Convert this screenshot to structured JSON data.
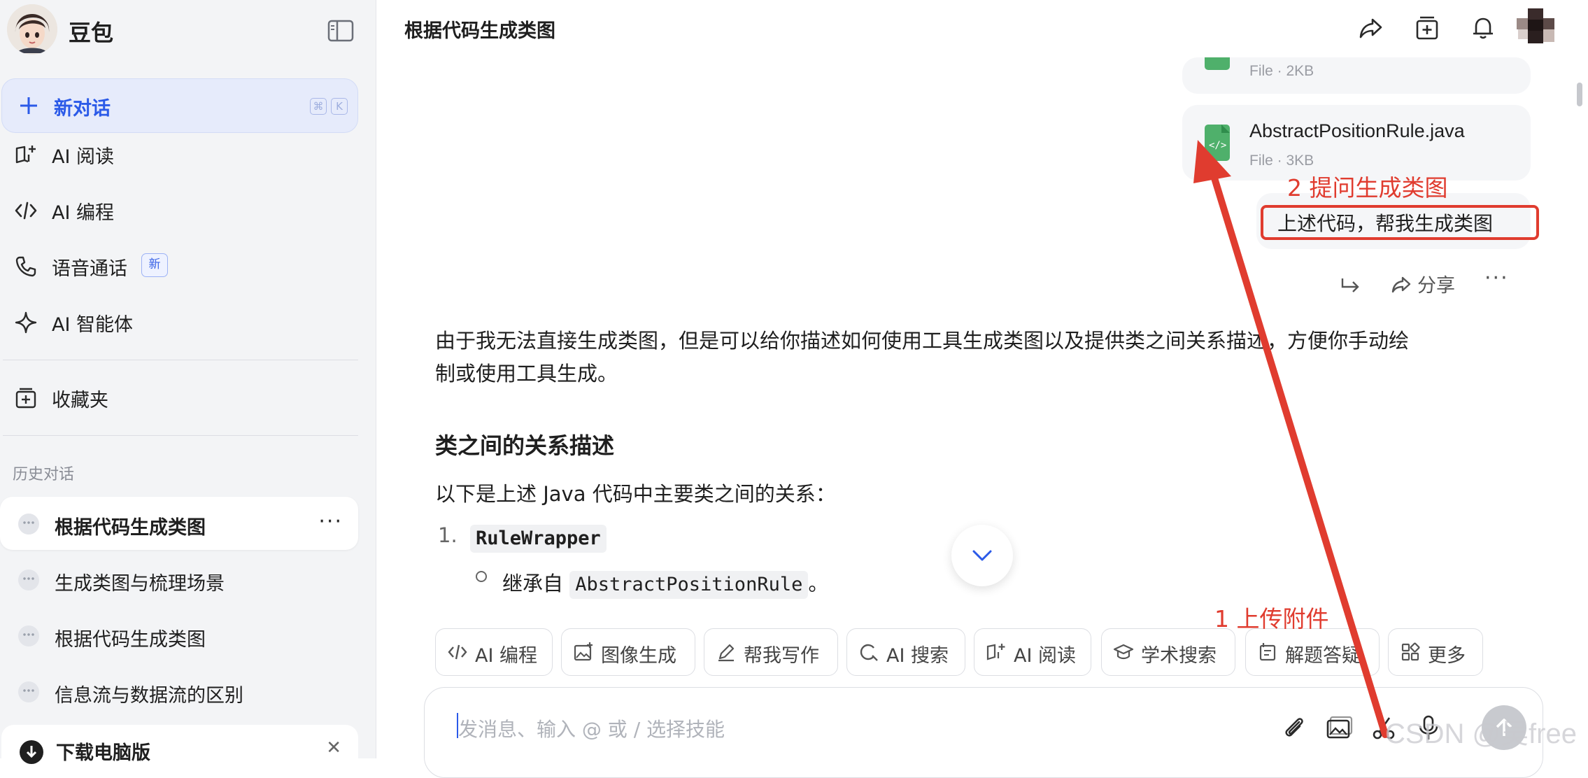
{
  "sidebar": {
    "brand": "豆包",
    "new_chat": "新对话",
    "shortcut": [
      "⌘",
      "K"
    ],
    "nav": [
      {
        "label": "AI 阅读",
        "icon": "book-plus-icon"
      },
      {
        "label": "AI 编程",
        "icon": "code-icon"
      },
      {
        "label": "语音通话",
        "icon": "phone-icon"
      },
      {
        "label": "AI 智能体",
        "icon": "sparkle-icon"
      },
      {
        "label": "收藏夹",
        "icon": "bookmark-plus-icon"
      }
    ],
    "new_badge": "新",
    "history_title": "历史对话",
    "history": [
      {
        "label": "根据代码生成类图",
        "active": true
      },
      {
        "label": "生成类图与梳理场景",
        "active": false
      },
      {
        "label": "根据代码生成类图",
        "active": false
      },
      {
        "label": "信息流与数据流的区别",
        "active": false
      }
    ],
    "download": "下载电脑版"
  },
  "header": {
    "title": "根据代码生成类图"
  },
  "chat": {
    "files": [
      {
        "name": "",
        "meta": "File · 2KB"
      },
      {
        "name": "AbstractPositionRule.java",
        "meta": "File · 3KB"
      }
    ],
    "user_message": "上述代码，帮我生成类图",
    "actions": {
      "share": "分享"
    },
    "answer_intro_1": "由于我无法直接生成类图，但是可以给你描述如何使用工具生成类图以及提供类之间",
    "answer_intro_1b": "关系描述，方便你手动绘",
    "answer_intro_2": "制或使用工具生成。",
    "heading": "类之间的关系描述",
    "para": "以下是上述 Java 代码中主要类之间的关系：",
    "list_num": "1.",
    "class_name": "RuleWrapper",
    "sub_prefix": "继承自",
    "parent_class": "AbstractPositionRule",
    "sub_suffix": "。"
  },
  "skills": [
    {
      "label": "AI 编程",
      "icon": "code-icon"
    },
    {
      "label": "图像生成",
      "icon": "image-plus-icon"
    },
    {
      "label": "帮我写作",
      "icon": "pen-icon"
    },
    {
      "label": "AI 搜索",
      "icon": "search-icon"
    },
    {
      "label": "AI 阅读",
      "icon": "book-plus-icon"
    },
    {
      "label": "学术搜索",
      "icon": "graduation-cap-icon"
    },
    {
      "label": "解题答疑",
      "icon": "edu-icon"
    },
    {
      "label": "更多",
      "icon": "grid-icon"
    }
  ],
  "input": {
    "placeholder": "发消息、输入 @ 或 / 选择技能"
  },
  "annotations": {
    "step2": "2 提问生成类图",
    "step1": "1 上传附件",
    "watermark": "CSDN @吴free"
  },
  "colors": {
    "accent": "#2b5ae8",
    "annotation": "#e03c2f",
    "sidebar_bg": "#f3f4f6"
  }
}
